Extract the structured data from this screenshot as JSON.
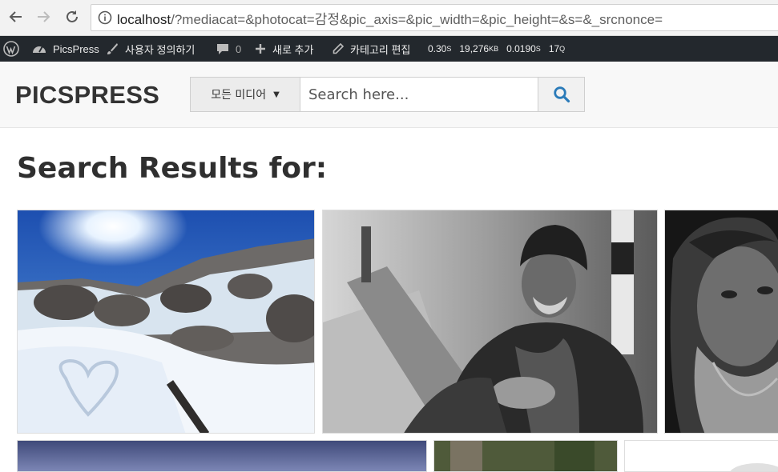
{
  "browser": {
    "url_host": "localhost",
    "url_rest": "/?mediacat=&photocat=감정&pic_axis=&pic_width=&pic_height=&s=&_srcnonce=",
    "back_icon": "arrow-left-icon",
    "forward_icon": "arrow-right-icon",
    "reload_icon": "reload-icon",
    "info_icon": "info-icon"
  },
  "adminbar": {
    "site_name": "PicsPress",
    "customize": "사용자 정의하기",
    "comments": "0",
    "new": "새로 추가",
    "edit_category": "카테고리 편집",
    "stat_time": "0.30",
    "stat_time_unit": "S",
    "stat_mem": "19,276",
    "stat_mem_unit": "KB",
    "stat_query_time": "0.0190",
    "stat_query_time_unit": "S",
    "stat_queries": "17",
    "stat_queries_unit": "Q"
  },
  "header": {
    "logo": "PICSPRESS",
    "media_dropdown": "모든 미디어",
    "search_placeholder": "Search here..."
  },
  "main": {
    "heading": "Search Results for:"
  },
  "colors": {
    "adminbar_bg": "#23282d",
    "search_icon": "#2b7bb9"
  }
}
